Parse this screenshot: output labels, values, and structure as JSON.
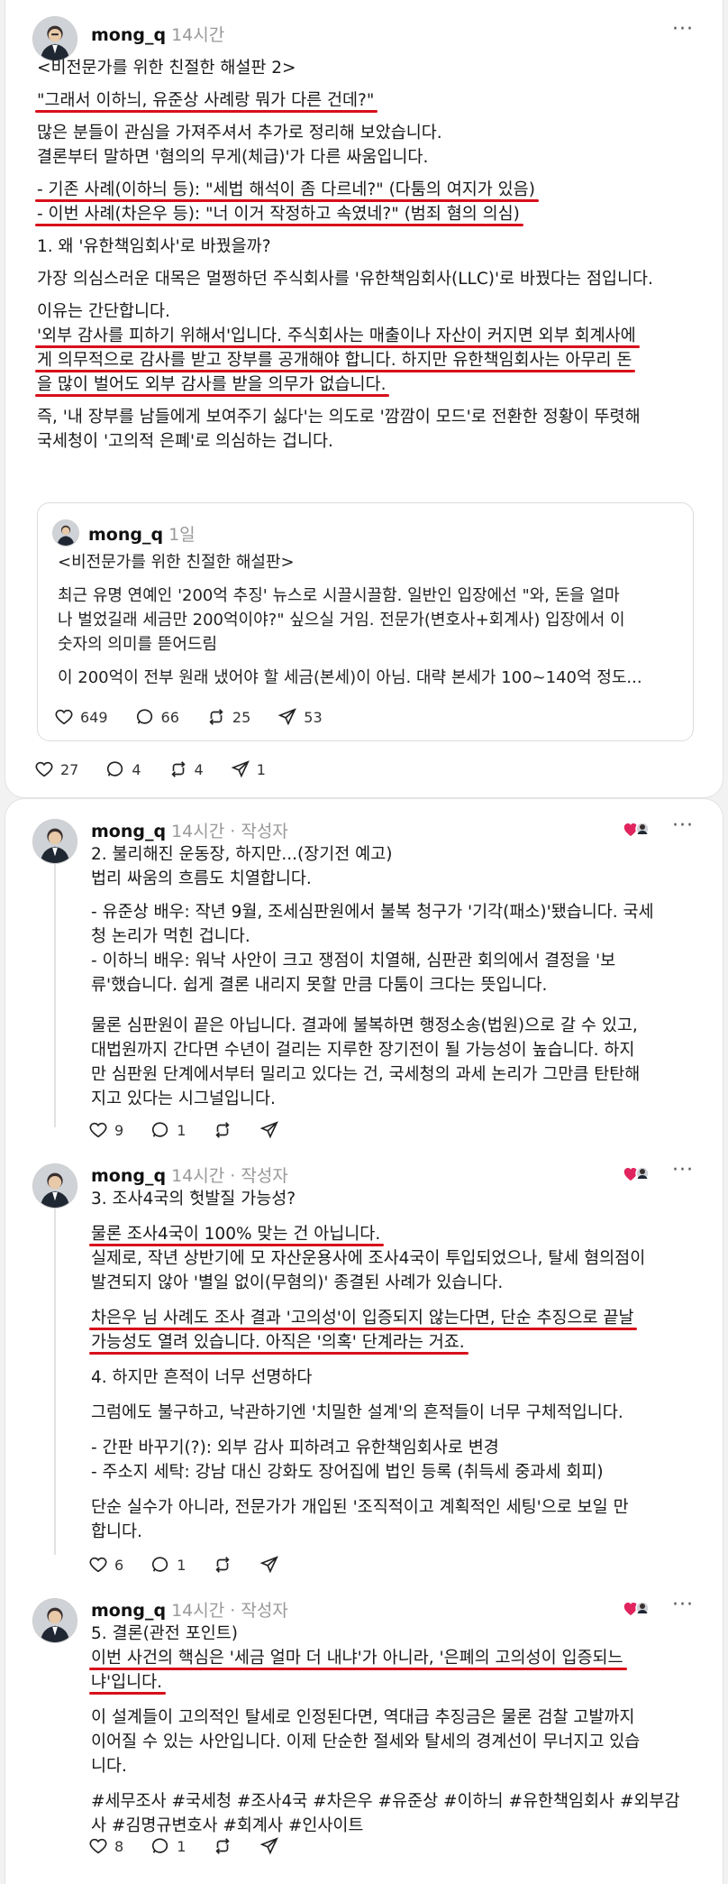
{
  "posts": [
    {
      "username": "mong_q",
      "time": "14시간",
      "more": "···",
      "paragraphs": [
        [
          "<비전문가를 위한 친절한 해설판 2>"
        ],
        [
          "\"그래서 이하늬, 유준상 사례랑 뭐가 다른 건데?\""
        ],
        [
          "많은 분들이 관심을 가져주셔서 추가로 정리해 보았습니다.",
          "결론부터 말하면 '혐의의 무게(체급)'가 다른 싸움입니다."
        ],
        [
          "- 기존 사례(이하늬 등): \"세법 해석이 좀 다르네?\" (다툼의 여지가 있음)",
          "- 이번 사례(차은우 등): \"너 이거 작정하고 속였네?\" (범죄 혐의 의심)"
        ],
        [
          "1. 왜 '유한책임회사'로 바꿨을까?"
        ],
        [
          "가장 의심스러운 대목은 멀쩡하던 주식회사를 '유한책임회사(LLC)'로 바꿨다는 점입니다."
        ],
        [
          "이유는 간단합니다.",
          "'외부 감사를 피하기 위해서'입니다. 주식회사는 매출이나 자산이 커지면 외부 회계사에",
          "게 의무적으로 감사를 받고 장부를 공개해야 합니다. 하지만 유한책임회사는 아무리 돈",
          "을 많이 벌어도 외부 감사를 받을 의무가 없습니다."
        ],
        [
          "즉, '내 장부를 남들에게 보여주기 싫다'는 의도로 '깜깜이 모드'로 전환한 정황이 뚜렷해",
          "국세청이 '고의적 은폐'로 의심하는 겁니다."
        ]
      ],
      "quoted": {
        "username": "mong_q",
        "time": "1일",
        "lines": [
          "<비전문가를 위한 친절한 해설판>",
          "최근 유명 연예인 '200억 추징' 뉴스로 시끌시끌함. 일반인 입장에선 \"와, 돈을 얼마",
          "나 벌었길래 세금만 200억이야?\" 싶으실 거임. 전문가(변호사+회계사) 입장에서 이",
          "숫자의 의미를 뜯어드림",
          "이 200억이 전부 원래 냈어야 할 세금(본세)이 아님. 대략 본세가 100~140억 정도..."
        ],
        "likes": "649",
        "comments": "66",
        "reposts": "25",
        "shares": "53"
      },
      "likes": "27",
      "comments": "4",
      "reposts": "4",
      "shares": "1"
    },
    {
      "username": "mong_q",
      "time": "14시간 · 작성자",
      "more": "···",
      "paragraphs": [
        [
          "2. 불리해진 운동장, 하지만...(장기전 예고)",
          "법리 싸움의 흐름도 치열합니다."
        ],
        [
          "- 유준상 배우: 작년 9월, 조세심판원에서 불복 청구가 '기각(패소)'됐습니다. 국세",
          "청 논리가 먹힌 겁니다.",
          "- 이하늬 배우: 워낙 사안이 크고 쟁점이 치열해, 심판관 회의에서 결정을 '보",
          "류'했습니다. 쉽게 결론 내리지 못할 만큼 다툼이 크다는 뜻입니다."
        ],
        [
          "물론 심판원이 끝은 아닙니다. 결과에 불복하면 행정소송(법원)으로 갈 수 있고,",
          "대법원까지 간다면 수년이 걸리는 지루한 장기전이 될 가능성이 높습니다. 하지",
          "만 심판원 단계에서부터 밀리고 있다는 건, 국세청의 과세 논리가 그만큼 탄탄해",
          "지고 있다는 시그널입니다."
        ]
      ],
      "likes": "9",
      "comments": "1",
      "reposts": "",
      "shares": ""
    },
    {
      "username": "mong_q",
      "time": "14시간 · 작성자",
      "more": "···",
      "paragraphs": [
        [
          "3. 조사4국의 헛발질 가능성?"
        ],
        [
          "물론 조사4국이 100% 맞는 건 아닙니다.",
          "실제로, 작년 상반기에 모 자산운용사에 조사4국이 투입되었으나, 탈세 혐의점이",
          "발견되지 않아 '별일 없이(무혐의)' 종결된 사례가 있습니다."
        ],
        [
          "차은우 님 사례도 조사 결과 '고의성'이 입증되지 않는다면, 단순 추징으로 끝날",
          "가능성도 열려 있습니다. 아직은 '의혹' 단계라는 거죠."
        ],
        [
          "4. 하지만 흔적이 너무 선명하다"
        ],
        [
          "그럼에도 불구하고, 낙관하기엔 '치밀한 설계'의 흔적들이 너무 구체적입니다."
        ],
        [
          "- 간판 바꾸기(?): 외부 감사 피하려고 유한책임회사로 변경",
          "- 주소지 세탁: 강남 대신 강화도 장어집에 법인 등록 (취득세 중과세 회피)"
        ],
        [
          "단순 실수가 아니라, 전문가가 개입된 '조직적이고 계획적인 세팅'으로 보일 만",
          "합니다."
        ]
      ],
      "likes": "6",
      "comments": "1",
      "reposts": "",
      "shares": ""
    },
    {
      "username": "mong_q",
      "time": "14시간 · 작성자",
      "more": "···",
      "paragraphs": [
        [
          "5. 결론(관전 포인트)",
          "이번 사건의 핵심은 '세금 얼마 더 내냐'가 아니라, '은폐의 고의성이 입증되느",
          "냐'입니다."
        ],
        [
          "이 설계들이 고의적인 탈세로 인정된다면, 역대급 추징금은 물론 검찰 고발까지",
          "이어질 수 있는 사안입니다. 이제 단순한 절세와 탈세의 경계선이 무너지고 있습",
          "니다."
        ],
        [
          "#세무조사 #국세청 #조사4국 #차은우 #유준상 #이하늬 #유한책임회사 #외부감",
          "사 #김명규변호사 #회계사 #인사이트"
        ]
      ],
      "likes": "8",
      "comments": "1",
      "reposts": "",
      "shares": ""
    }
  ],
  "colors": {
    "underline": "#d8101a",
    "muted": "#999999",
    "heart": "#e0245e"
  },
  "icons": [
    "heart-icon",
    "comment-icon",
    "repost-icon",
    "share-icon",
    "more-icon",
    "avatar"
  ]
}
